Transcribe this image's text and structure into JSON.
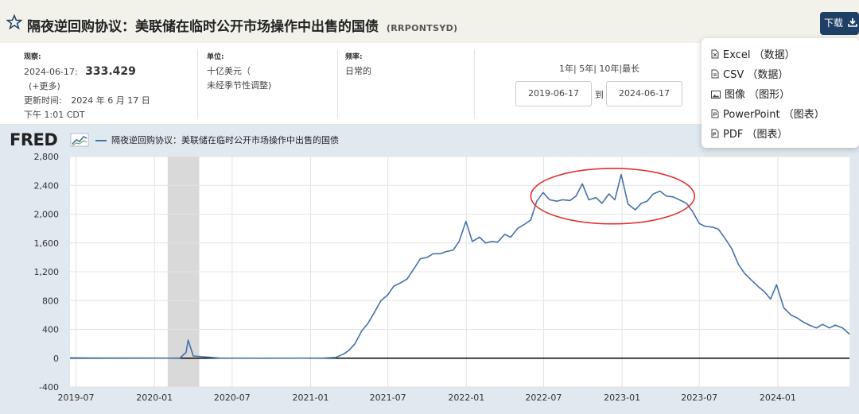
{
  "title": "隔夜逆回购协议：美联储在临时公开市场操作中出售的国债",
  "series_id": "(RRPONTSYD)",
  "download": {
    "label": "下载"
  },
  "observation": {
    "label": "观察:",
    "date": "2024-06-17:",
    "value": "333.429",
    "more": "(+更多)",
    "updated_label": "更新时间:",
    "updated_date": "2024 年 6 月 17 日",
    "updated_time": "下午 1:01 CDT"
  },
  "units": {
    "label": "单位:",
    "line1": "十亿美元（",
    "line2": "未经季节性调整)"
  },
  "frequency": {
    "label": "频率:",
    "value": "日常的"
  },
  "range": {
    "links": "1年| 5年| 10年|最长",
    "start": "2019-06-17",
    "to": "到",
    "end": "2024-06-17"
  },
  "download_menu": [
    {
      "name": "excel",
      "label": "Excel  （数据）"
    },
    {
      "name": "csv",
      "label": "CSV  （数据）"
    },
    {
      "name": "image",
      "label": "图像  （图形）"
    },
    {
      "name": "powerpoint",
      "label": "PowerPoint  （图表）"
    },
    {
      "name": "pdf",
      "label": "PDF  （图表）"
    }
  ],
  "fred_logo": "FRED",
  "colors": {
    "series": "#4572a7",
    "recession": "#d9d9d9",
    "annotation": "#e03030",
    "background": "#e1e9f0"
  },
  "chart_data": {
    "type": "line",
    "title": "",
    "legend": "隔夜逆回购协议：美联储在临时公开市场操作中出售的国债",
    "xlabel": "",
    "ylabel": "",
    "ylim": [
      -400,
      2800
    ],
    "xlim": [
      "2019-06-17",
      "2024-06-17"
    ],
    "yticks": [
      "-400",
      "0",
      "400",
      "800",
      "1,200",
      "1,600",
      "2,000",
      "2,400",
      "2,800"
    ],
    "xticks": [
      "2019-07",
      "2020-01",
      "2020-07",
      "2021-01",
      "2021-07",
      "2022-01",
      "2022-07",
      "2023-01",
      "2023-07",
      "2024-01"
    ],
    "grid": true,
    "recession_shading": [
      "2020-02",
      "2020-04"
    ],
    "annotation": {
      "shape": "ellipse",
      "color": "red",
      "from": "2022-06",
      "to": "2023-06"
    },
    "series": [
      {
        "name": "隔夜逆回购协议：美联储在临时公开市场操作中出售的国债",
        "x": [
          "2019-06-17",
          "2019-09-01",
          "2019-12-01",
          "2020-02-01",
          "2020-03-01",
          "2020-03-15",
          "2020-03-20",
          "2020-04-01",
          "2020-06-01",
          "2020-09-01",
          "2020-12-01",
          "2021-02-01",
          "2021-03-01",
          "2021-03-20",
          "2021-04-01",
          "2021-04-15",
          "2021-05-01",
          "2021-05-15",
          "2021-06-01",
          "2021-06-15",
          "2021-07-01",
          "2021-07-15",
          "2021-08-01",
          "2021-08-15",
          "2021-09-01",
          "2021-09-15",
          "2021-10-01",
          "2021-10-15",
          "2021-11-01",
          "2021-11-15",
          "2021-12-01",
          "2021-12-15",
          "2021-12-31",
          "2022-01-15",
          "2022-02-01",
          "2022-02-15",
          "2022-03-01",
          "2022-03-15",
          "2022-04-01",
          "2022-04-15",
          "2022-05-01",
          "2022-05-15",
          "2022-06-01",
          "2022-06-15",
          "2022-06-30",
          "2022-07-15",
          "2022-08-01",
          "2022-08-15",
          "2022-09-01",
          "2022-09-15",
          "2022-09-30",
          "2022-10-15",
          "2022-11-01",
          "2022-11-15",
          "2022-12-01",
          "2022-12-15",
          "2022-12-30",
          "2023-01-15",
          "2023-02-01",
          "2023-02-15",
          "2023-03-01",
          "2023-03-15",
          "2023-03-31",
          "2023-04-15",
          "2023-05-01",
          "2023-05-15",
          "2023-06-01",
          "2023-06-15",
          "2023-07-01",
          "2023-07-15",
          "2023-08-01",
          "2023-08-15",
          "2023-09-01",
          "2023-09-15",
          "2023-10-01",
          "2023-10-15",
          "2023-11-01",
          "2023-11-15",
          "2023-12-01",
          "2023-12-15",
          "2023-12-29",
          "2024-01-15",
          "2024-02-01",
          "2024-02-15",
          "2024-03-01",
          "2024-03-15",
          "2024-04-01",
          "2024-04-15",
          "2024-05-01",
          "2024-05-15",
          "2024-06-01",
          "2024-06-17"
        ],
        "values": [
          5,
          3,
          2,
          1,
          3,
          80,
          250,
          30,
          2,
          0,
          1,
          3,
          10,
          60,
          110,
          200,
          380,
          480,
          650,
          800,
          880,
          1000,
          1050,
          1100,
          1250,
          1380,
          1400,
          1450,
          1450,
          1480,
          1500,
          1620,
          1900,
          1620,
          1680,
          1600,
          1620,
          1610,
          1720,
          1680,
          1800,
          1850,
          1920,
          2180,
          2300,
          2200,
          2180,
          2200,
          2190,
          2250,
          2420,
          2200,
          2230,
          2150,
          2280,
          2200,
          2550,
          2140,
          2060,
          2150,
          2180,
          2280,
          2320,
          2250,
          2240,
          2200,
          2150,
          2040,
          1870,
          1830,
          1820,
          1790,
          1650,
          1520,
          1300,
          1180,
          1080,
          1000,
          920,
          820,
          1020,
          700,
          600,
          560,
          500,
          460,
          420,
          470,
          420,
          460,
          420,
          333.429
        ]
      }
    ]
  }
}
